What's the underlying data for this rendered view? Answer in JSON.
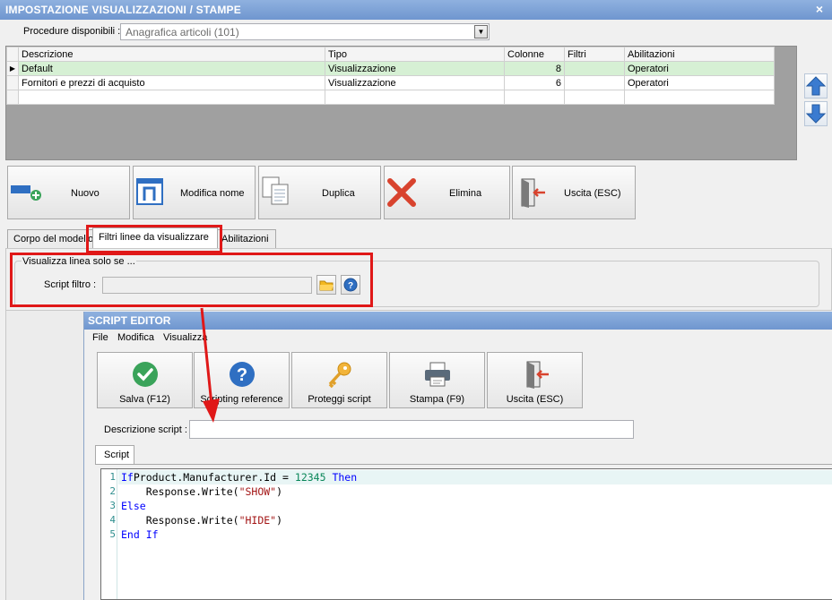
{
  "window": {
    "title": "IMPOSTAZIONE VISUALIZZAZIONI / STAMPE",
    "close": "×"
  },
  "procedures": {
    "label": "Procedure disponibili :",
    "value": "Anagrafica articoli (101)"
  },
  "grid": {
    "headers": [
      "Descrizione",
      "Tipo",
      "Colonne",
      "Filtri",
      "Abilitazioni"
    ],
    "rows": [
      {
        "descrizione": "Default",
        "tipo": "Visualizzazione",
        "colonne": "8",
        "filtri": "",
        "abilitazioni": "Operatori"
      },
      {
        "descrizione": "Fornitori e prezzi di acquisto",
        "tipo": "Visualizzazione",
        "colonne": "6",
        "filtri": "",
        "abilitazioni": "Operatori"
      }
    ]
  },
  "actions": {
    "nuovo": "Nuovo",
    "modifica": "Modifica nome",
    "duplica": "Duplica",
    "elimina": "Elimina",
    "uscita": "Uscita (ESC)"
  },
  "tabs": {
    "corpo": "Corpo del modello",
    "filtri": "Filtri linee da visualizzare",
    "abilitazioni": "Abilitazioni"
  },
  "filter_group": {
    "title": "Visualizza linea solo se ...",
    "script_label": "Script filtro :",
    "script_value": ""
  },
  "editor": {
    "title": "SCRIPT EDITOR",
    "menu": [
      "File",
      "Modifica",
      "Visualizza"
    ],
    "buttons": {
      "salva": "Salva (F12)",
      "reference": "Scripting reference",
      "proteggi": "Proteggi script",
      "stampa": "Stampa (F9)",
      "uscita": "Uscita (ESC)"
    },
    "desc_label": "Descrizione script :",
    "desc_value": "",
    "tab": "Script",
    "code": [
      {
        "n": "1",
        "parts": [
          [
            "kw",
            "If"
          ],
          [
            "",
            "Product.Manufacturer.Id"
          ],
          [
            "",
            " = "
          ],
          [
            "nm",
            "12345"
          ],
          [
            "",
            ""
          ],
          [
            "kw",
            " Then"
          ]
        ]
      },
      {
        "n": "2",
        "parts": [
          [
            "",
            "    Response.Write("
          ],
          [
            "str",
            "\"SHOW\""
          ],
          [
            "",
            ")"
          ]
        ]
      },
      {
        "n": "3",
        "parts": [
          [
            "kw",
            "Else"
          ]
        ]
      },
      {
        "n": "4",
        "parts": [
          [
            "",
            "    Response.Write("
          ],
          [
            "str",
            "\"HIDE\""
          ],
          [
            "",
            ")"
          ]
        ]
      },
      {
        "n": "5",
        "parts": [
          [
            "kw",
            "End If"
          ]
        ]
      }
    ]
  },
  "colors": {
    "title_bar": "#7aa0d6",
    "selected_row": "#d6f0d4",
    "highlight": "#e01818",
    "check_green": "#3aa35a",
    "help_blue": "#2f6fc2"
  }
}
